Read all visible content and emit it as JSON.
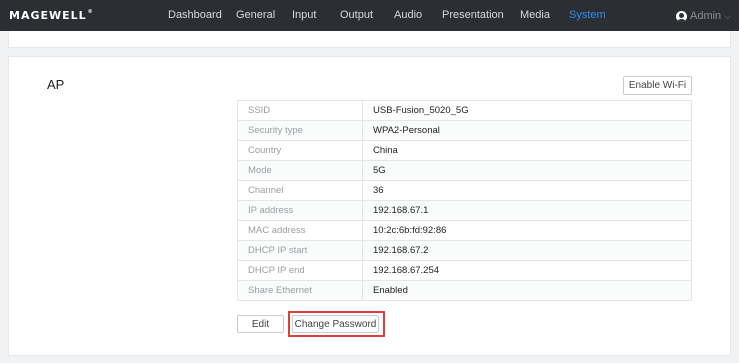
{
  "header": {
    "logo": "MAGEWELL",
    "logo_mark": "®",
    "nav": [
      "Dashboard",
      "General",
      "Input",
      "Output",
      "Audio",
      "Presentation",
      "Media",
      "System"
    ],
    "active_nav": "System",
    "user": "Admin",
    "accent_color": "#2f8ef6",
    "bar_color": "#2b2f33"
  },
  "ap": {
    "title": "AP",
    "enable_wifi_label": "Enable Wi-Fi",
    "rows": [
      {
        "key": "SSID",
        "value": "USB-Fusion_5020_5G"
      },
      {
        "key": "Security type",
        "value": "WPA2-Personal"
      },
      {
        "key": "Country",
        "value": "China"
      },
      {
        "key": "Mode",
        "value": "5G"
      },
      {
        "key": "Channel",
        "value": "36"
      },
      {
        "key": "IP address",
        "value": "192.168.67.1"
      },
      {
        "key": "MAC address",
        "value": "10:2c:6b:fd:92:86"
      },
      {
        "key": "DHCP IP start",
        "value": "192.168.67.2"
      },
      {
        "key": "DHCP IP end",
        "value": "192.168.67.254"
      },
      {
        "key": "Share Ethernet",
        "value": "Enabled"
      }
    ],
    "edit_label": "Edit",
    "change_password_label": "Change Password",
    "highlight_color": "#dc3c3c"
  }
}
